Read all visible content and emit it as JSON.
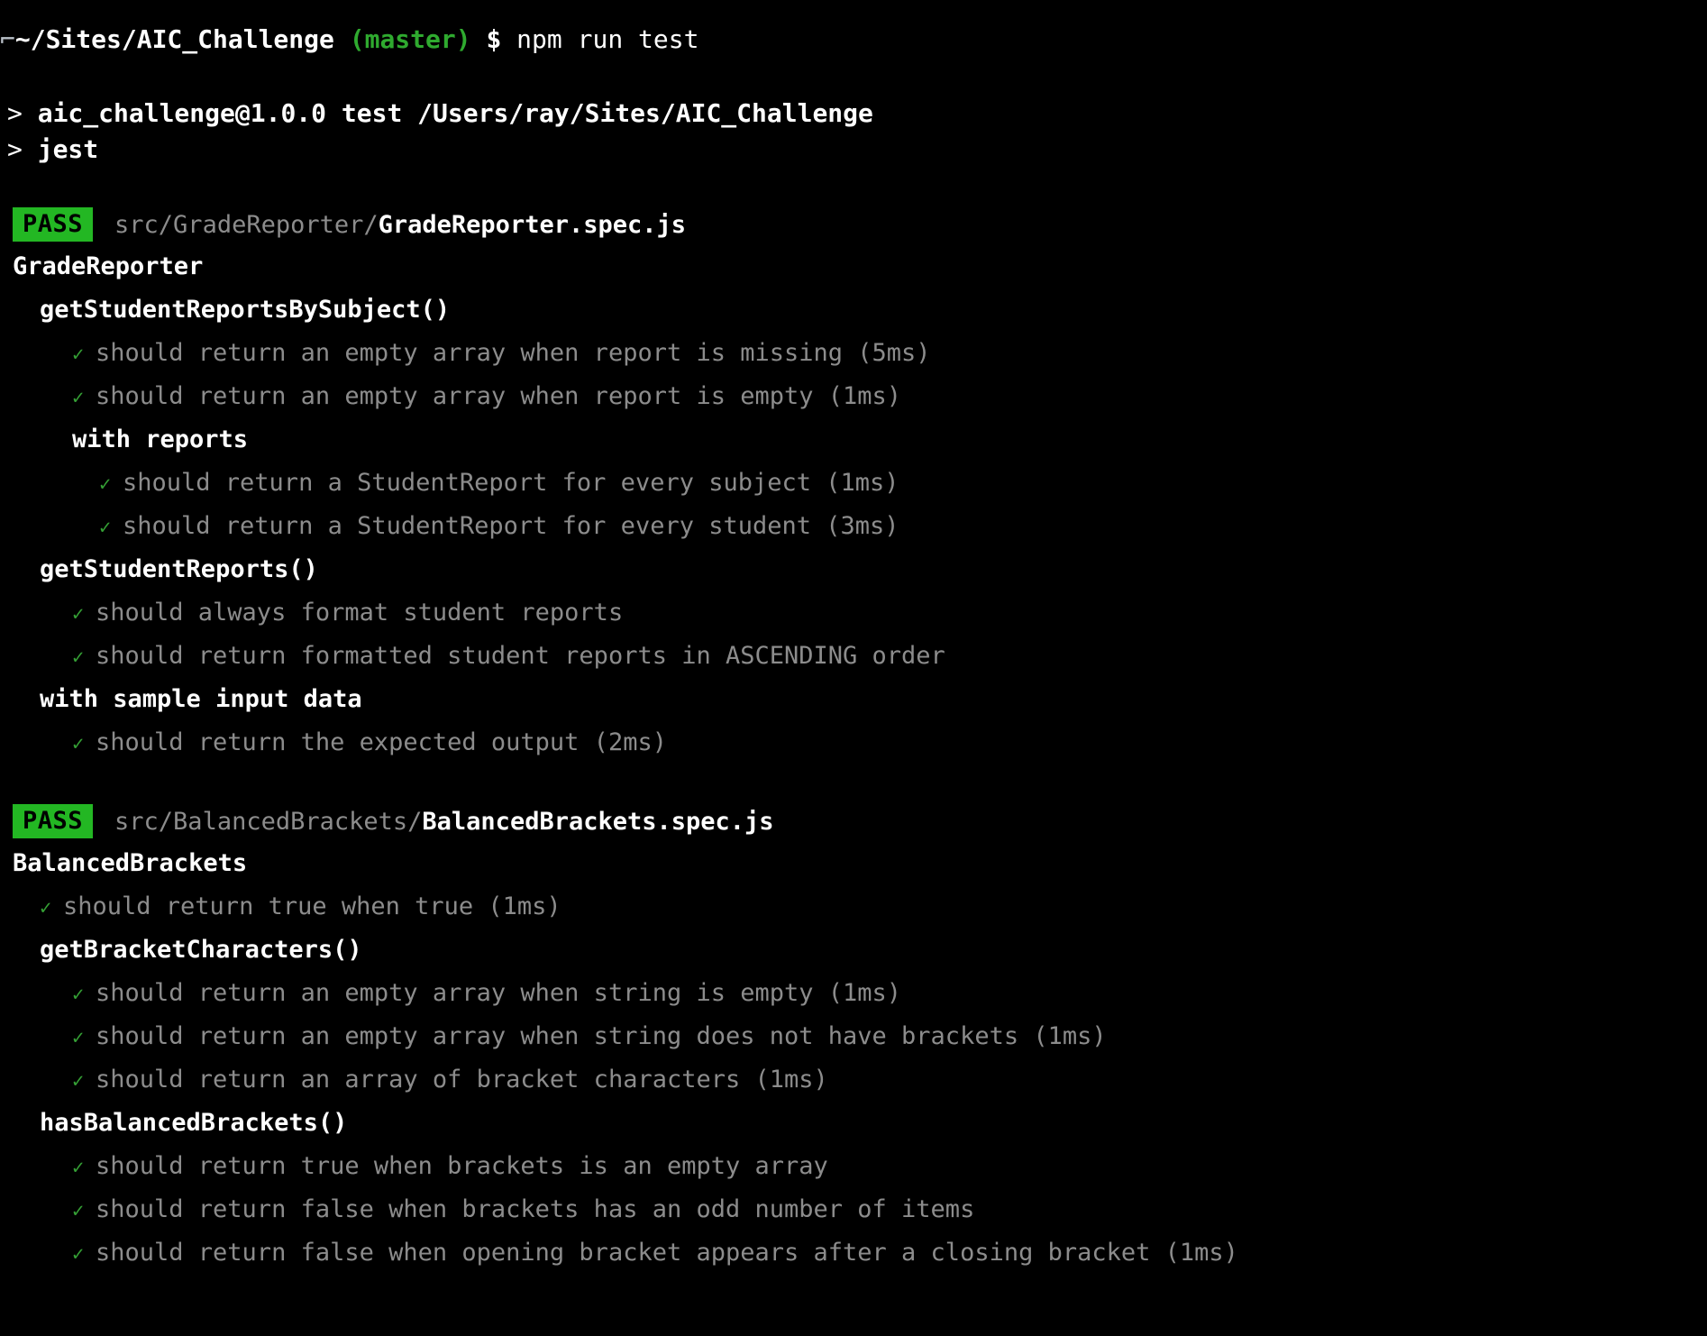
{
  "terminal": {
    "background": "#000000",
    "prompt": {
      "bracket": "⌐",
      "path": "~/Sites/AIC_Challenge",
      "branch": "(master)",
      "dollar": "$",
      "command": "npm run test",
      "branch_color": "#2faa2f"
    },
    "npm_output": [
      {
        "chevron": ">",
        "text": "aic_challenge@1.0.0 test /Users/ray/Sites/AIC_Challenge"
      },
      {
        "chevron": ">",
        "text": "jest"
      }
    ],
    "status_colors": {
      "pass_badge_bg": "#23b723",
      "pass_badge_fg": "#000000",
      "check_green": "#35a035",
      "dim_gray": "#8c8c8c",
      "bright_white": "#ffffff"
    },
    "suites": [
      {
        "status": "PASS",
        "path_dim": "src/GradeReporter/",
        "path_file": "GradeReporter.spec.js",
        "rows": [
          {
            "kind": "describe",
            "indent": 0,
            "label": "GradeReporter"
          },
          {
            "kind": "describe",
            "indent": 1,
            "label": "getStudentReportsBySubject()"
          },
          {
            "kind": "test",
            "indent": 2,
            "check": "✓",
            "label": "should return an empty array when report is missing (5ms)"
          },
          {
            "kind": "test",
            "indent": 2,
            "check": "✓",
            "label": "should return an empty array when report is empty (1ms)"
          },
          {
            "kind": "describe",
            "indent": 2,
            "label": "with reports"
          },
          {
            "kind": "test",
            "indent": 3,
            "check": "✓",
            "label": "should return a StudentReport for every subject (1ms)"
          },
          {
            "kind": "test",
            "indent": 3,
            "check": "✓",
            "label": "should return a StudentReport for every student (3ms)"
          },
          {
            "kind": "describe",
            "indent": 1,
            "label": "getStudentReports()"
          },
          {
            "kind": "test",
            "indent": 2,
            "check": "✓",
            "label": "should always format student reports"
          },
          {
            "kind": "test",
            "indent": 2,
            "check": "✓",
            "label": "should return formatted student reports in ASCENDING order"
          },
          {
            "kind": "describe",
            "indent": 1,
            "label": "with sample input data"
          },
          {
            "kind": "test",
            "indent": 2,
            "check": "✓",
            "label": "should return the expected output (2ms)"
          }
        ]
      },
      {
        "status": "PASS",
        "path_dim": "src/BalancedBrackets/",
        "path_file": "BalancedBrackets.spec.js",
        "rows": [
          {
            "kind": "describe",
            "indent": 0,
            "label": "BalancedBrackets"
          },
          {
            "kind": "test",
            "indent": 1,
            "check": "✓",
            "label": "should return true when true (1ms)"
          },
          {
            "kind": "describe",
            "indent": 1,
            "label": "getBracketCharacters()"
          },
          {
            "kind": "test",
            "indent": 2,
            "check": "✓",
            "label": "should return an empty array when string is empty (1ms)"
          },
          {
            "kind": "test",
            "indent": 2,
            "check": "✓",
            "label": "should return an empty array when string does not have brackets (1ms)"
          },
          {
            "kind": "test",
            "indent": 2,
            "check": "✓",
            "label": "should return an array of bracket characters (1ms)"
          },
          {
            "kind": "describe",
            "indent": 1,
            "label": "hasBalancedBrackets()"
          },
          {
            "kind": "test",
            "indent": 2,
            "check": "✓",
            "label": "should return true when brackets is an empty array"
          },
          {
            "kind": "test",
            "indent": 2,
            "check": "✓",
            "label": "should return false when brackets has an odd number of items"
          },
          {
            "kind": "test",
            "indent": 2,
            "check": "✓",
            "label": "should return false when opening bracket appears after a closing bracket (1ms)"
          }
        ]
      }
    ]
  }
}
